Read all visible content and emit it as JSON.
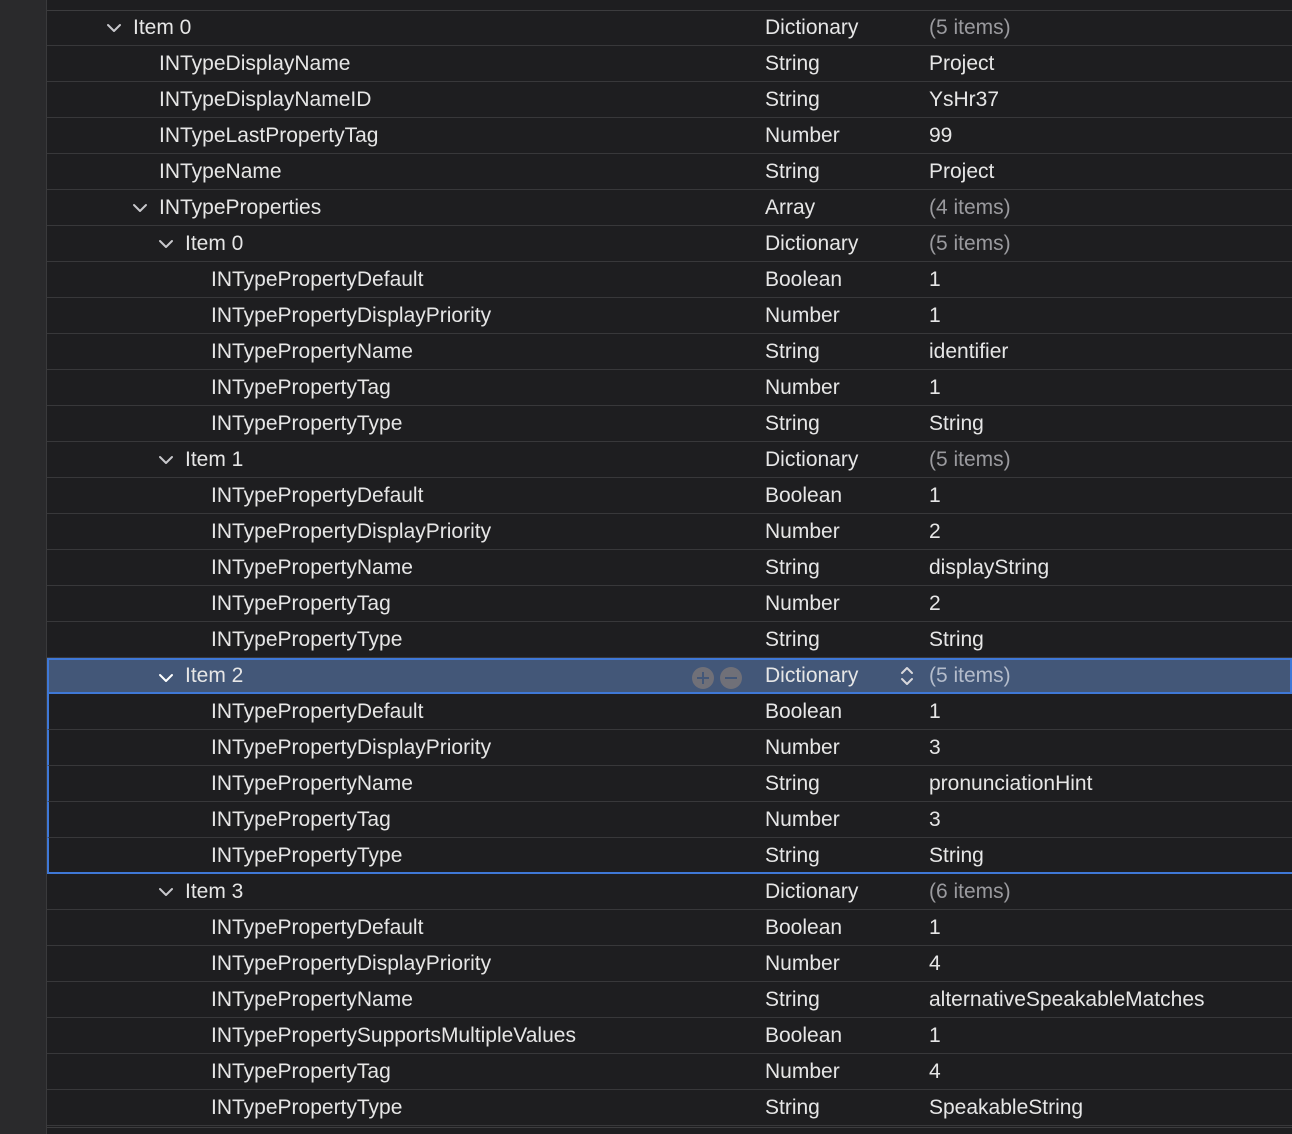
{
  "rows": [
    {
      "key": "Item 0",
      "type": "Dictionary",
      "value": "(5 items)"
    },
    {
      "key": "INTypeDisplayName",
      "type": "String",
      "value": "Project"
    },
    {
      "key": "INTypeDisplayNameID",
      "type": "String",
      "value": "YsHr37"
    },
    {
      "key": "INTypeLastPropertyTag",
      "type": "Number",
      "value": "99"
    },
    {
      "key": "INTypeName",
      "type": "String",
      "value": "Project"
    },
    {
      "key": "INTypeProperties",
      "type": "Array",
      "value": "(4 items)"
    },
    {
      "key": "Item 0",
      "type": "Dictionary",
      "value": "(5 items)"
    },
    {
      "key": "INTypePropertyDefault",
      "type": "Boolean",
      "value": "1"
    },
    {
      "key": "INTypePropertyDisplayPriority",
      "type": "Number",
      "value": "1"
    },
    {
      "key": "INTypePropertyName",
      "type": "String",
      "value": "identifier"
    },
    {
      "key": "INTypePropertyTag",
      "type": "Number",
      "value": "1"
    },
    {
      "key": "INTypePropertyType",
      "type": "String",
      "value": "String"
    },
    {
      "key": "Item 1",
      "type": "Dictionary",
      "value": "(5 items)"
    },
    {
      "key": "INTypePropertyDefault",
      "type": "Boolean",
      "value": "1"
    },
    {
      "key": "INTypePropertyDisplayPriority",
      "type": "Number",
      "value": "2"
    },
    {
      "key": "INTypePropertyName",
      "type": "String",
      "value": "displayString"
    },
    {
      "key": "INTypePropertyTag",
      "type": "Number",
      "value": "2"
    },
    {
      "key": "INTypePropertyType",
      "type": "String",
      "value": "String"
    },
    {
      "key": "Item 2",
      "type": "Dictionary",
      "value": "(5 items)"
    },
    {
      "key": "INTypePropertyDefault",
      "type": "Boolean",
      "value": "1"
    },
    {
      "key": "INTypePropertyDisplayPriority",
      "type": "Number",
      "value": "3"
    },
    {
      "key": "INTypePropertyName",
      "type": "String",
      "value": "pronunciationHint"
    },
    {
      "key": "INTypePropertyTag",
      "type": "Number",
      "value": "3"
    },
    {
      "key": "INTypePropertyType",
      "type": "String",
      "value": "String"
    },
    {
      "key": "Item 3",
      "type": "Dictionary",
      "value": "(6 items)"
    },
    {
      "key": "INTypePropertyDefault",
      "type": "Boolean",
      "value": "1"
    },
    {
      "key": "INTypePropertyDisplayPriority",
      "type": "Number",
      "value": "4"
    },
    {
      "key": "INTypePropertyName",
      "type": "String",
      "value": "alternativeSpeakableMatches"
    },
    {
      "key": "INTypePropertySupportsMultipleValues",
      "type": "Boolean",
      "value": "1"
    },
    {
      "key": "INTypePropertyTag",
      "type": "Number",
      "value": "4"
    },
    {
      "key": "INTypePropertyType",
      "type": "String",
      "value": "SpeakableString"
    }
  ],
  "icons": {
    "disclosure": "chevron-down-icon",
    "add": "plus-circle-icon",
    "remove": "minus-circle-icon",
    "type_popup": "up-down-stepper-icon"
  },
  "colors": {
    "background": "#1e1e20",
    "selection": "#435778",
    "selection_border": "#3f78d6",
    "muted_value": "#9a9a9e"
  }
}
